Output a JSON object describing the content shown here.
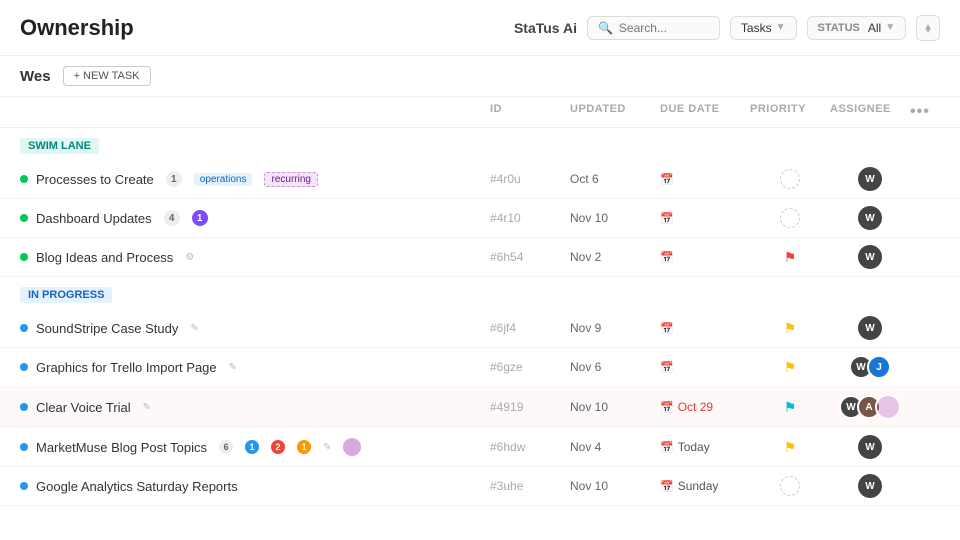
{
  "header": {
    "title": "Ownership",
    "app_name": "StaTus Ai",
    "search_placeholder": "Search...",
    "tasks_label": "Tasks",
    "status_label": "STATUS",
    "status_value": "All",
    "filter_icon": "▼"
  },
  "sub_header": {
    "user": "Wes",
    "new_task_label": "+ NEW TASK"
  },
  "table": {
    "columns": [
      "ID",
      "UPDATED",
      "DUE DATE",
      "PRIORITY",
      "ASSIGNEE",
      ""
    ],
    "sections": [
      {
        "label": "SWIM LANE",
        "type": "swim-lane",
        "rows": [
          {
            "name": "Processes to Create",
            "badge": "1",
            "badge_type": "gray",
            "tags": [
              "operations",
              "recurring"
            ],
            "id": "#4r0u",
            "updated": "Oct 6",
            "due_date": "",
            "due_date_type": "normal",
            "priority": "ghost",
            "assignee": "dark",
            "dot": "green"
          },
          {
            "name": "Dashboard Updates",
            "badge": "4",
            "badge_type": "gray",
            "badge2": "1",
            "badge2_type": "purple",
            "tags": [],
            "id": "#4r10",
            "updated": "Nov 10",
            "due_date": "",
            "due_date_type": "normal",
            "priority": "ghost",
            "assignee": "dark",
            "dot": "green"
          },
          {
            "name": "Blog Ideas and Process",
            "badge": "",
            "badge_type": "",
            "tags": [],
            "id": "#6h54",
            "updated": "Nov 2",
            "due_date": "",
            "due_date_type": "normal",
            "priority": "red",
            "assignee": "dark",
            "dot": "green"
          }
        ]
      },
      {
        "label": "IN PROGRESS",
        "type": "in-progress",
        "rows": [
          {
            "name": "SoundStripe Case Study",
            "badge": "",
            "tags": [],
            "id": "#6jf4",
            "updated": "Nov 9",
            "due_date": "",
            "due_date_type": "normal",
            "priority": "yellow",
            "assignee": "dark",
            "dot": "blue"
          },
          {
            "name": "Graphics for Trello Import Page",
            "badge": "",
            "tags": [],
            "id": "#6gze",
            "updated": "Nov 6",
            "due_date": "",
            "due_date_type": "normal",
            "priority": "yellow",
            "assignee": "multi",
            "dot": "blue"
          },
          {
            "name": "Clear Voice Trial",
            "badge": "",
            "tags": [],
            "id": "#4919",
            "updated": "Nov 10",
            "due_date": "Oct 29",
            "due_date_type": "overdue",
            "priority": "cyan",
            "assignee": "multi2",
            "dot": "blue"
          },
          {
            "name": "MarketMuse Blog Post Topics",
            "badge": "",
            "tags": [],
            "id": "#6hdw",
            "updated": "Nov 4",
            "due_date": "Today",
            "due_date_type": "today",
            "priority": "yellow",
            "assignee": "dark",
            "dot": "blue"
          },
          {
            "name": "Google Analytics Saturday Reports",
            "badge": "",
            "tags": [],
            "id": "#3uhe",
            "updated": "Nov 10",
            "due_date": "Sunday",
            "due_date_type": "normal",
            "priority": "ghost",
            "assignee": "dark",
            "dot": "blue"
          }
        ]
      }
    ]
  }
}
